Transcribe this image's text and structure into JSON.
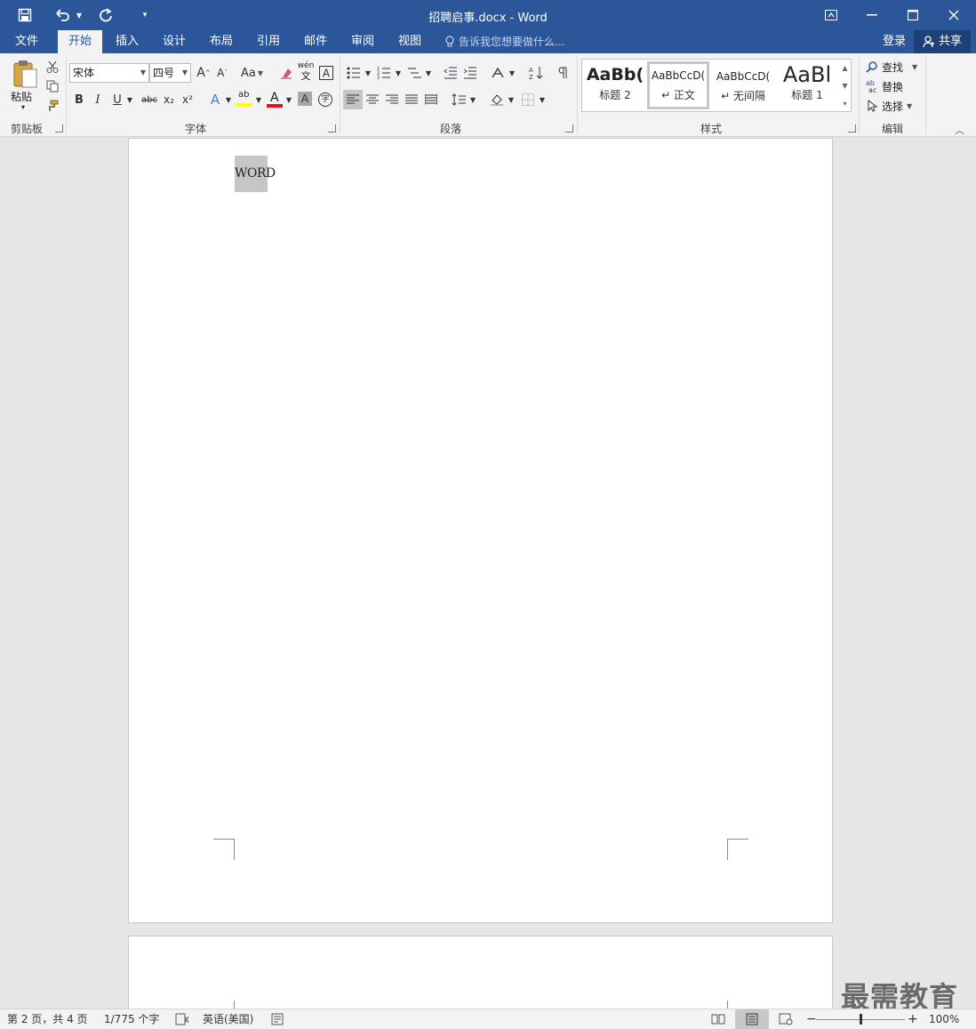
{
  "titlebar": {
    "title": "招聘启事.docx - Word"
  },
  "tabs": [
    {
      "label": "文件"
    },
    {
      "label": "开始"
    },
    {
      "label": "插入"
    },
    {
      "label": "设计"
    },
    {
      "label": "布局"
    },
    {
      "label": "引用"
    },
    {
      "label": "邮件"
    },
    {
      "label": "审阅"
    },
    {
      "label": "视图"
    }
  ],
  "tellme": {
    "placeholder": "告诉我您想要做什么..."
  },
  "account": {
    "login": "登录",
    "share": "共享"
  },
  "ribbon": {
    "clipboard": {
      "paste": "粘贴",
      "label": "剪贴板"
    },
    "font": {
      "name": "宋体",
      "size": "四号",
      "label": "字体",
      "change_case": "Aa",
      "phonetic": "wén",
      "phonetic2": "文",
      "bold": "B",
      "italic": "I",
      "underline": "U",
      "strike": "abc",
      "sub": "x₂",
      "sup": "x²",
      "char_shade": "A",
      "enclose": "字",
      "font_color_letter": "A",
      "text_effect": "A",
      "highlight": "ab"
    },
    "paragraph": {
      "label": "段落"
    },
    "styles": {
      "label": "样式",
      "items": [
        {
          "sample": "AaBb(",
          "name": "标题 2"
        },
        {
          "sample": "AaBbCcD(",
          "name": "↵ 正文"
        },
        {
          "sample": "AaBbCcD(",
          "name": "↵ 无间隔"
        },
        {
          "sample": "AaBl",
          "name": "标题 1"
        }
      ]
    },
    "editing": {
      "label": "编辑",
      "find": "查找",
      "replace": "替换",
      "select": "选择"
    }
  },
  "document": {
    "selected_text": "WORD"
  },
  "statusbar": {
    "page": "第 2 页，共 4 页",
    "words": "1/775 个字",
    "language": "英语(美国)",
    "zoom": "100%",
    "zoom_level": 1.0
  },
  "watermark": "最需教育",
  "colors": {
    "brand": "#2b579a",
    "highlight": "#ffff00",
    "font_color": "#e81123"
  }
}
